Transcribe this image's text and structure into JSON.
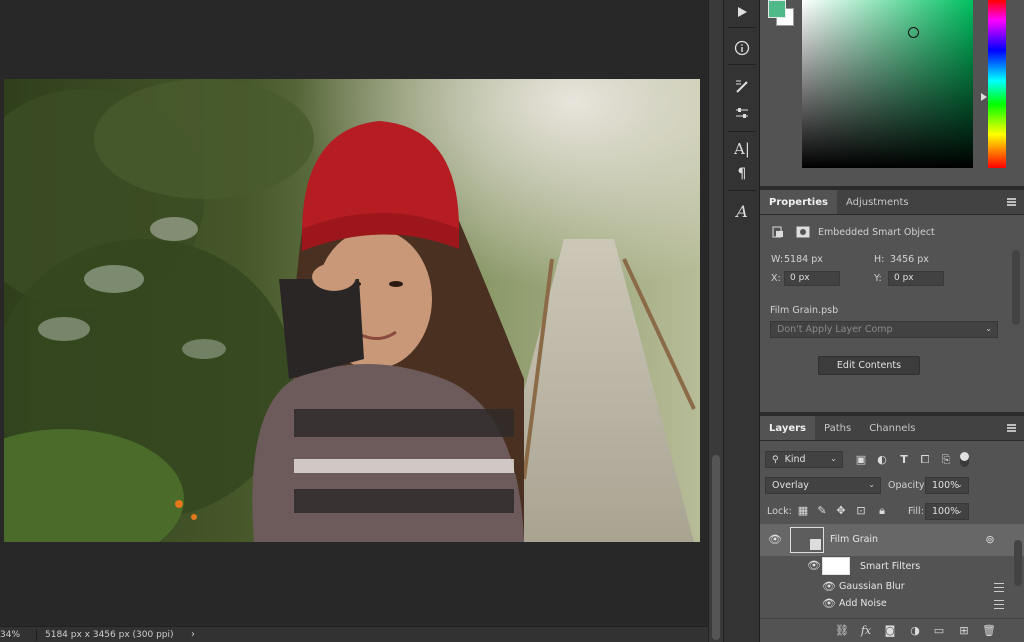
{
  "status": {
    "zoom": "34%",
    "doc_info": "5184 px x 3456 px (300 ppi)",
    "arrow": "›"
  },
  "colors": {
    "foreground": "#4fb98a",
    "background": "#ffffff"
  },
  "properties": {
    "tabs": [
      "Properties",
      "Adjustments"
    ],
    "object_type": "Embedded Smart Object",
    "w_label": "W:",
    "w_value": "5184 px",
    "h_label": "H:",
    "h_value": "3456 px",
    "x_label": "X:",
    "x_value": "0 px",
    "y_label": "Y:",
    "y_value": "0 px",
    "file_name": "Film Grain.psb",
    "layer_comp_placeholder": "Don't Apply Layer Comp",
    "edit_contents_label": "Edit Contents"
  },
  "layers": {
    "tabs": [
      "Layers",
      "Paths",
      "Channels"
    ],
    "kind_label": "Kind",
    "blend_mode": "Overlay",
    "opacity_label": "Opacity:",
    "opacity_value": "100%",
    "lock_label": "Lock:",
    "fill_label": "Fill:",
    "fill_value": "100%",
    "items": [
      {
        "name": "Film Grain"
      },
      {
        "name": "Smart Filters"
      },
      {
        "name": "Gaussian Blur"
      },
      {
        "name": "Add Noise"
      }
    ]
  },
  "footer_icons": [
    "link-icon",
    "fx-icon",
    "mask-icon",
    "adjustment-icon",
    "folder-icon",
    "new-layer-icon",
    "trash-icon"
  ]
}
